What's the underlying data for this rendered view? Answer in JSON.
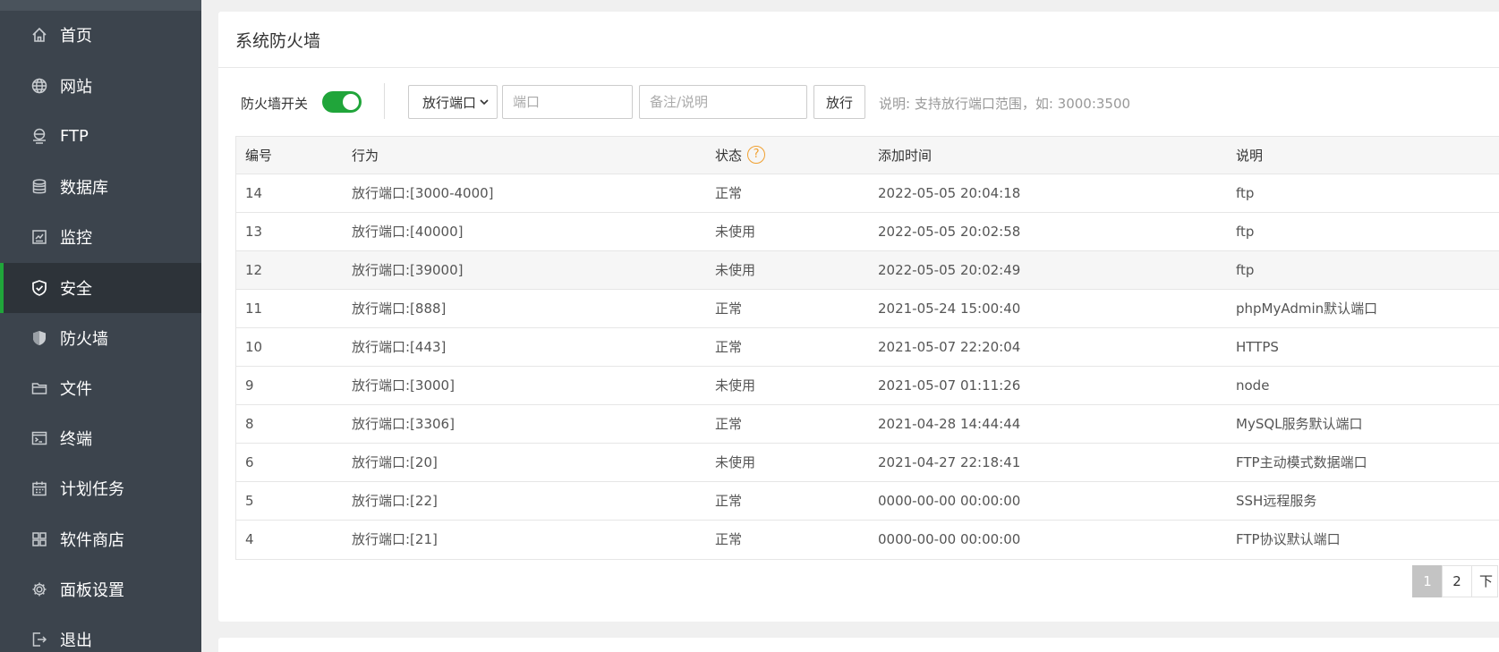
{
  "sidebar": {
    "items": [
      {
        "label": "首页",
        "icon": "home-icon"
      },
      {
        "label": "网站",
        "icon": "globe-icon"
      },
      {
        "label": "FTP",
        "icon": "ftp-icon"
      },
      {
        "label": "数据库",
        "icon": "database-icon"
      },
      {
        "label": "监控",
        "icon": "monitor-icon"
      },
      {
        "label": "安全",
        "icon": "shield-check-icon",
        "active": true
      },
      {
        "label": "防火墙",
        "icon": "shield-icon"
      },
      {
        "label": "文件",
        "icon": "folder-icon"
      },
      {
        "label": "终端",
        "icon": "terminal-icon"
      },
      {
        "label": "计划任务",
        "icon": "calendar-icon"
      },
      {
        "label": "软件商店",
        "icon": "apps-icon"
      },
      {
        "label": "面板设置",
        "icon": "gear-icon"
      },
      {
        "label": "退出",
        "icon": "logout-icon"
      }
    ]
  },
  "panel": {
    "title": "系统防火墙"
  },
  "toolbar": {
    "firewall_label": "防火墙开关",
    "firewall_enabled": true,
    "select_value": "放行端口",
    "port_placeholder": "端口",
    "note_placeholder": "备注/说明",
    "submit_label": "放行",
    "hint": "说明: 支持放行端口范围，如: 3000:3500"
  },
  "table": {
    "headers": [
      "编号",
      "行为",
      "状态",
      "添加时间",
      "说明"
    ],
    "rows": [
      [
        "14",
        "放行端口:[3000-4000]",
        "正常",
        "2022-05-05 20:04:18",
        "ftp"
      ],
      [
        "13",
        "放行端口:[40000]",
        "未使用",
        "2022-05-05 20:02:58",
        "ftp"
      ],
      [
        "12",
        "放行端口:[39000]",
        "未使用",
        "2022-05-05 20:02:49",
        "ftp"
      ],
      [
        "11",
        "放行端口:[888]",
        "正常",
        "2021-05-24 15:00:40",
        "phpMyAdmin默认端口"
      ],
      [
        "10",
        "放行端口:[443]",
        "正常",
        "2021-05-07 22:20:04",
        "HTTPS"
      ],
      [
        "9",
        "放行端口:[3000]",
        "未使用",
        "2021-05-07 01:11:26",
        "node"
      ],
      [
        "8",
        "放行端口:[3306]",
        "正常",
        "2021-04-28 14:44:44",
        "MySQL服务默认端口"
      ],
      [
        "6",
        "放行端口:[20]",
        "未使用",
        "2021-04-27 22:18:41",
        "FTP主动模式数据端口"
      ],
      [
        "5",
        "放行端口:[22]",
        "正常",
        "0000-00-00 00:00:00",
        "SSH远程服务"
      ],
      [
        "4",
        "放行端口:[21]",
        "正常",
        "0000-00-00 00:00:00",
        "FTP协议默认端口"
      ]
    ]
  },
  "pagination": {
    "pages": [
      "1",
      "2"
    ],
    "current": "1",
    "next_label": "下"
  },
  "colors": {
    "sidebar_bg": "#3c444d",
    "accent": "#20a53a",
    "help_icon": "#f0a030"
  }
}
